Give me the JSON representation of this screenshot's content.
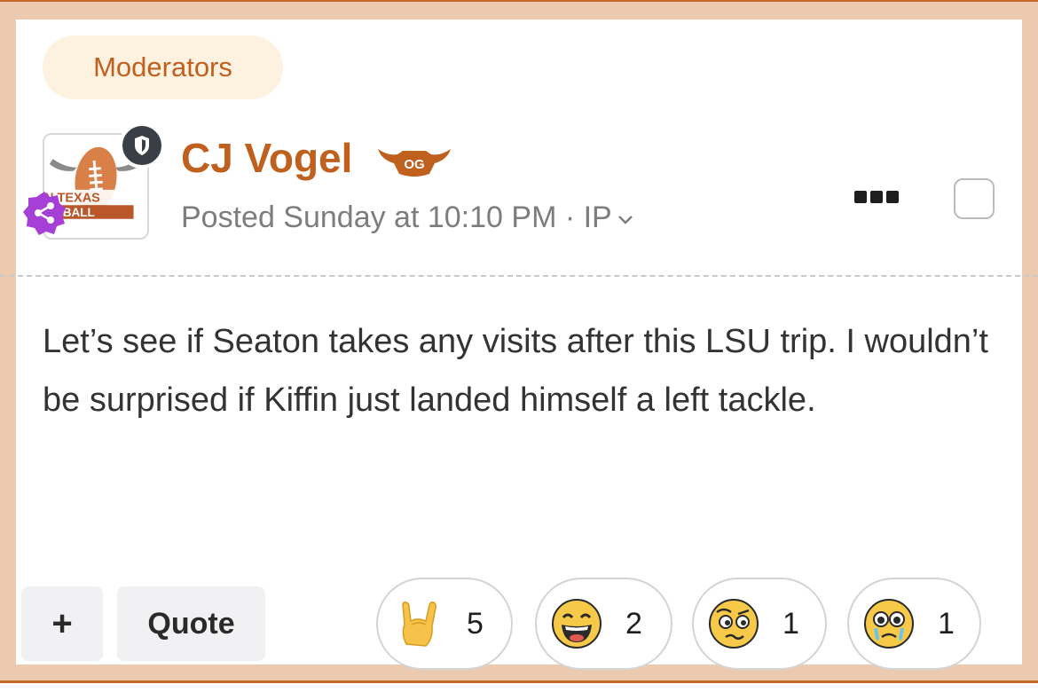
{
  "group_badge": {
    "label": "Moderators"
  },
  "author": {
    "name": "CJ Vogel",
    "avatar_text": [
      "N TEXAS",
      "OTBALL"
    ],
    "badges": [
      "shield-icon",
      "share-network-icon",
      "og-longhorn-badge"
    ],
    "og_badge_text": "OG"
  },
  "post_meta": {
    "text": "Posted Sunday at 10:10 PM · IP",
    "caret_icon": "chevron-down-icon"
  },
  "post": {
    "body": "Let’s see if Seaton takes any visits after this LSU trip. I wouldn’t be surprised if Kiffin just landed himself a left tackle."
  },
  "actions": {
    "plus_label": "+",
    "quote_label": "Quote"
  },
  "reactions": [
    {
      "icon": "horns-hand-emoji",
      "count": "5"
    },
    {
      "icon": "laughing-face-emoji",
      "count": "2"
    },
    {
      "icon": "confused-face-emoji",
      "count": "1"
    },
    {
      "icon": "crying-face-emoji",
      "count": "1"
    }
  ],
  "colors": {
    "accent": "#c0601f",
    "frame": "#eccab0",
    "frame_border": "#c8692c",
    "badge_bg": "#fdf1e0",
    "share_badge": "#a63fd6",
    "mod_badge": "#3a3f47"
  }
}
